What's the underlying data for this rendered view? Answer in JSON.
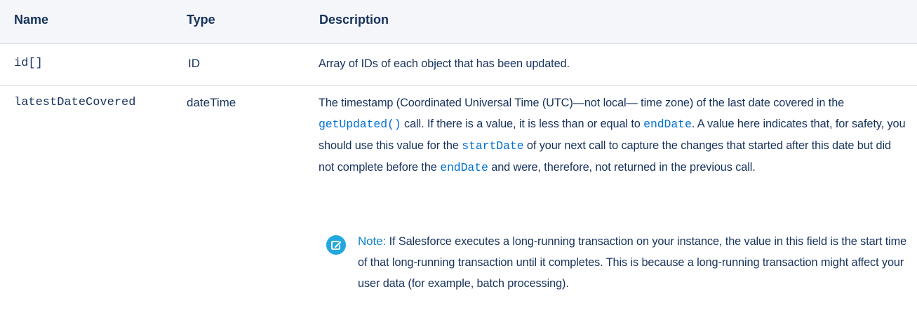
{
  "table": {
    "headers": {
      "name": "Name",
      "type": "Type",
      "description": "Description"
    },
    "rows": [
      {
        "name": "id[]",
        "type": "ID",
        "description": "Array of IDs of each object that has been updated."
      },
      {
        "name": "latestDateCovered",
        "type": "dateTime",
        "description_parts": {
          "p1": "The timestamp (Coordinated Universal Time (UTC)—not local— time zone) of the last date covered in the ",
          "link1": "getUpdated()",
          "p2": " call. If there is a value, it is less than or equal to ",
          "link2": "endDate",
          "p3": ". A value here indicates that, for safety, you should use this value for the ",
          "link3": "startDate",
          "p4": " of your next call to capture the changes that started after this date but did not complete before the ",
          "link4": "endDate",
          "p5": " and were, therefore, not returned in the previous call."
        },
        "note": {
          "label": "Note:",
          "text": " If Salesforce executes a long-running transaction on your instance, the value in this field is the start time of that long-running transaction until it completes. This is because a long-running transaction might affect your user data (for example, batch processing).",
          "icon": "note-edit-icon"
        }
      }
    ]
  },
  "colors": {
    "header_bg": "#f4f6f9",
    "text": "#16325c",
    "link": "#0070d2",
    "note_accent": "#22a7e0",
    "border": "#d8dde6"
  }
}
